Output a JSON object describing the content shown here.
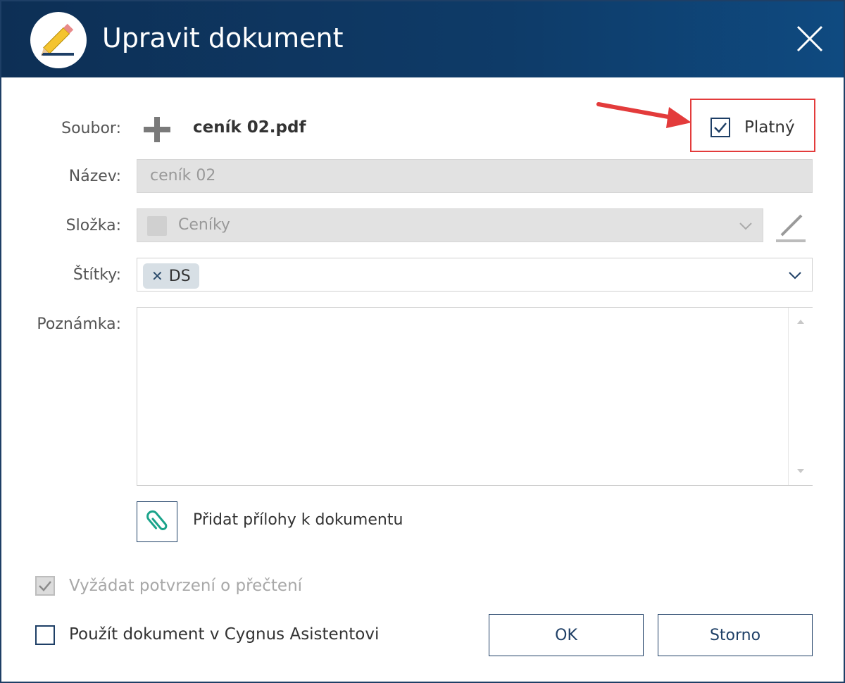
{
  "dialog": {
    "title": "Upravit dokument"
  },
  "form": {
    "file_label": "Soubor:",
    "file_name": "ceník 02.pdf",
    "valid_label": "Platný",
    "name_label": "Název:",
    "name_value": "ceník 02",
    "folder_label": "Složka:",
    "folder_value": "Ceníky",
    "tags_label": "Štítky:",
    "tags": [
      "DS"
    ],
    "note_label": "Poznámka:",
    "note_value": "",
    "attach_label": "Přidat přílohy k dokumentu"
  },
  "options": {
    "read_receipt_label": "Vyžádat potvrzení o přečtení",
    "read_receipt_checked": true,
    "cygnus_label": "Použít dokument v Cygnus Asistentovi",
    "cygnus_checked": false,
    "valid_checked": true
  },
  "buttons": {
    "ok": "OK",
    "cancel": "Storno"
  },
  "colors": {
    "title_bar": "#0e3b68",
    "accent": "#1e3f66",
    "highlight": "#e33b3b",
    "attach_icon": "#1aa38a"
  },
  "icons": {
    "title": "pencil-icon",
    "close": "close-icon",
    "add": "plus-icon",
    "folder_edit": "pencil-icon",
    "dropdown": "chevron-down-icon",
    "attach": "paperclip-icon",
    "check": "checkmark-icon",
    "annotation": "red-arrow-icon"
  }
}
